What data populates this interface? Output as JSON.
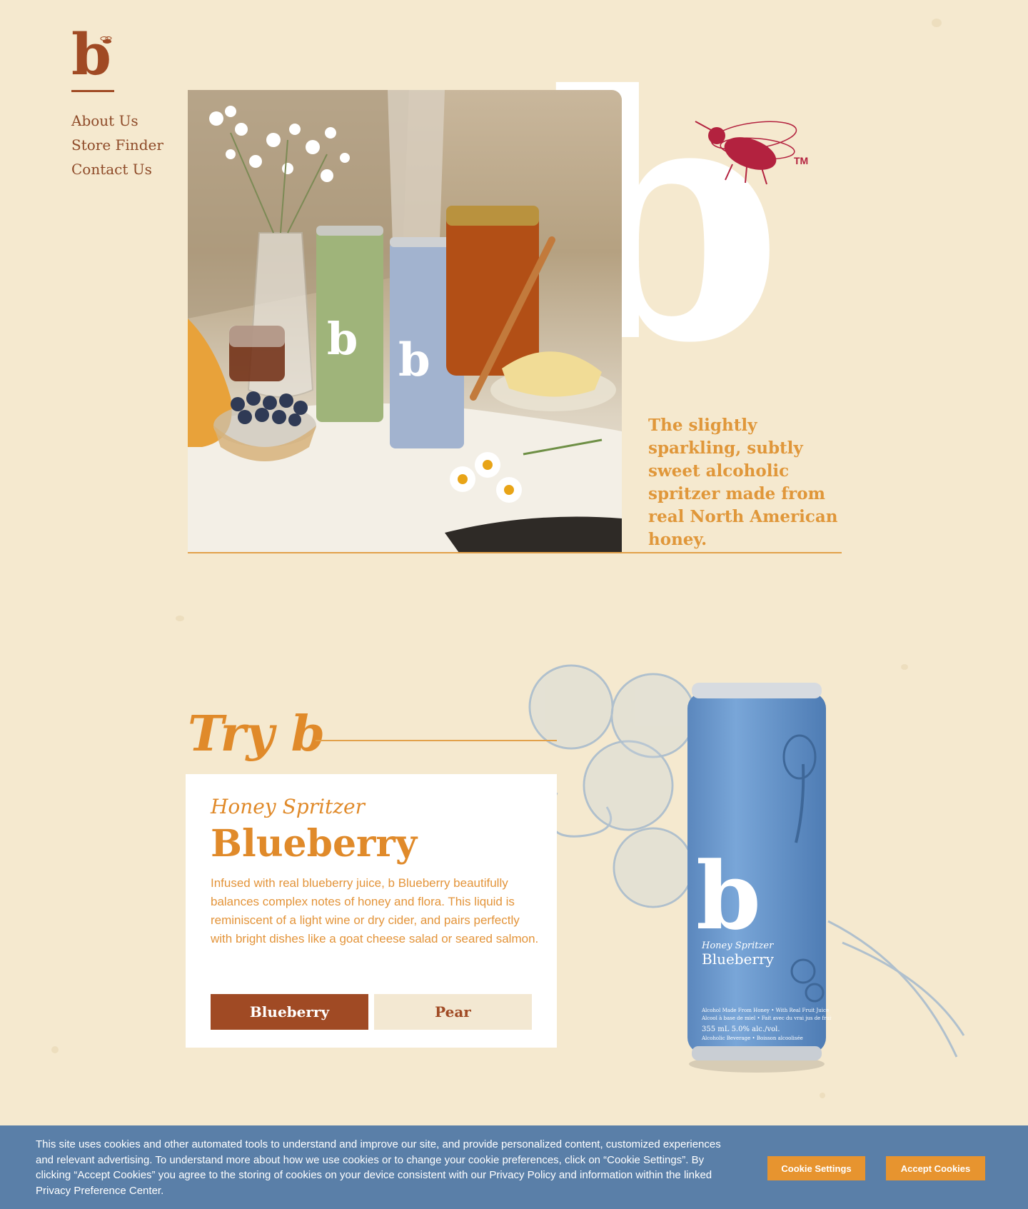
{
  "brand": {
    "logo_letter": "b",
    "big_letter": "b",
    "trademark": "TM",
    "accent_color": "#a04a24",
    "honey_color": "#e08a2a"
  },
  "nav": {
    "items": [
      {
        "label": "About Us"
      },
      {
        "label": "Store Finder"
      },
      {
        "label": "Contact Us"
      }
    ]
  },
  "hero": {
    "tagline": "The slightly sparkling, subtly sweet alcoholic spritzer made from real North American honey.",
    "photo_can_letters": [
      "b",
      "b"
    ]
  },
  "try_section": {
    "title": "Try b",
    "card": {
      "subtitle": "Honey Spritzer",
      "title": "Blueberry",
      "description": "Infused with real blueberry juice, b Blueberry beautifully balances complex notes of honey and flora. This liquid is reminiscent of a light wine or dry cider, and pairs perfectly with bright dishes like a goat cheese salad or seared salmon.",
      "flavors": [
        {
          "label": "Blueberry",
          "selected": true
        },
        {
          "label": "Pear",
          "selected": false
        }
      ]
    },
    "can": {
      "letter": "b",
      "subtitle": "Honey Spritzer",
      "flavor": "Blueberry",
      "line1": "Alcohol Made From Honey • With Real Fruit Juice",
      "line2": "Alcool à base de miel • Fait avec du vrai jus de fruits",
      "volume": "355 mL   5.0% alc./vol.",
      "line3": "Alcoholic Beverage • Boisson alcoolisée",
      "color": "#6f9ccf"
    }
  },
  "cookie_banner": {
    "text": "This site uses cookies and other automated tools to understand and improve our site, and provide personalized content, customized experiences and relevant advertising. To understand more about how we use cookies or to change your cookie preferences, click on “Cookie Settings”. By clicking “Accept Cookies” you agree to the storing of cookies on your device consistent with our Privacy Policy and information within the linked Privacy Preference Center.",
    "settings_label": "Cookie Settings",
    "accept_label": "Accept Cookies",
    "background": "#5a7fa8",
    "button_color": "#e7942f"
  }
}
